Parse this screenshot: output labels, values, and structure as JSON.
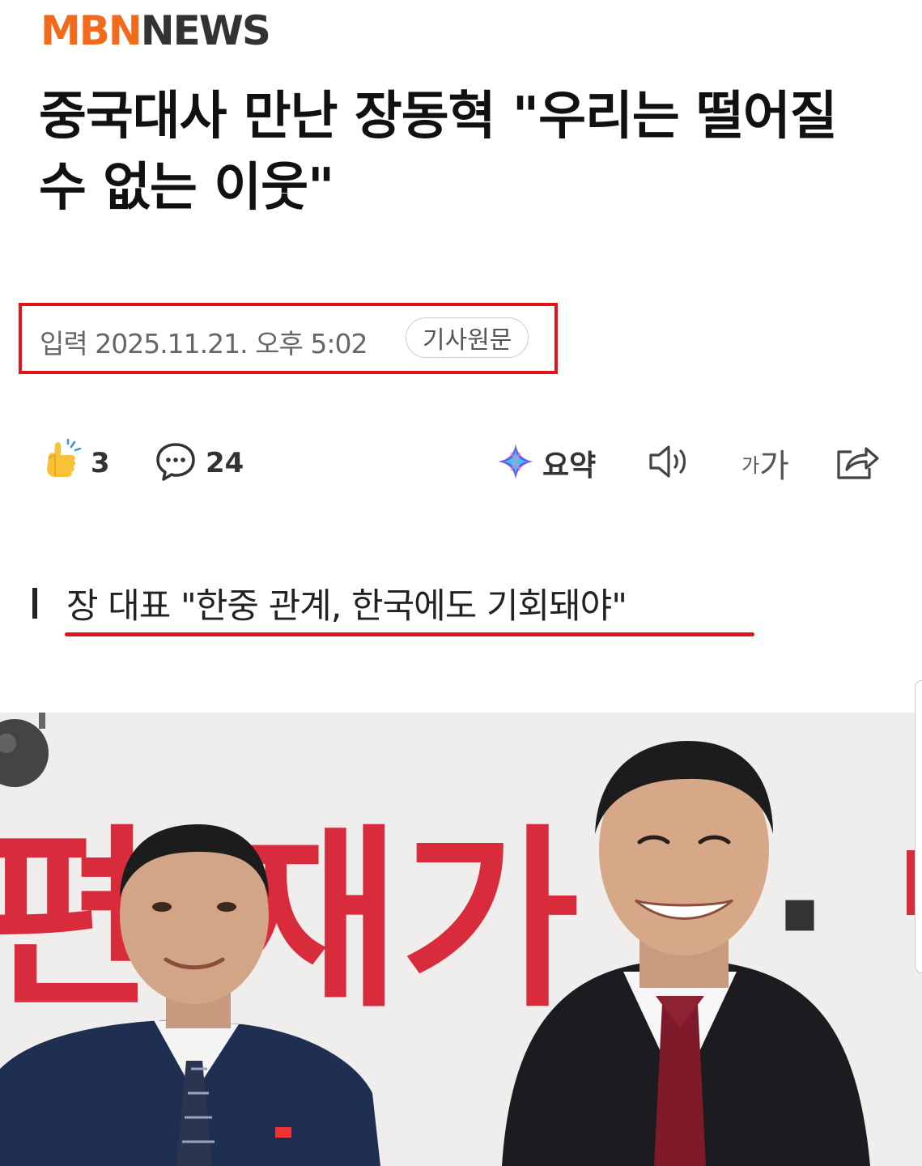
{
  "brand": {
    "part1": "MBN",
    "part2": "NEWS"
  },
  "headline": "중국대사 만난 장동혁 \"우리는 떨어질 수 없는 이웃\"",
  "meta": {
    "date": "입력 2025.11.21. 오후 5:02",
    "source_button": "기사원문"
  },
  "toolbar": {
    "like_count": "3",
    "comment_count": "24",
    "summary_label": "요약",
    "font_small": "가",
    "font_big": "가"
  },
  "subheadline": "장 대표 \"한중 관계, 한국에도 기회돼야\"",
  "photo": {
    "backdrop_text": "편 재가",
    "backdrop_text_right": "·"
  },
  "colors": {
    "brand_orange": "#f26a1b",
    "highlight_red": "#e3131b",
    "banner_red": "#d82c3c"
  }
}
